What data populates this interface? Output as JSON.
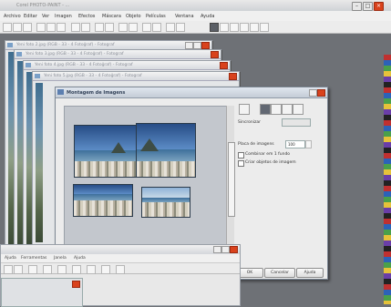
{
  "app": {
    "title": "Corel PHOTO-PAINT - ...",
    "menu": [
      "Archivo",
      "Editar",
      "Ver",
      "Imagen",
      "Efectos",
      "Máscara",
      "Objeto",
      "Películas",
      "Ventana",
      "Ayuda"
    ]
  },
  "documents": [
    {
      "title": "Yeni foto 2.jpg (RGB - 33 - 4 Fotoğraf) - Fotograf"
    },
    {
      "title": "Yeni foto 3.jpg (RGB - 33 - 4 Fotoğraf) - Fotograf"
    },
    {
      "title": "Yeni foto 4.jpg (RGB - 33 - 4 Fotoğraf) - Fotograf"
    },
    {
      "title": "Yeni foto 5.jpg (RGB - 33 - 4 Fotoğraf) - Fotograf"
    }
  ],
  "dialog": {
    "title": "Montagem de Imagens",
    "label_order": "Sincronizar",
    "label_size": "Placa de imagens",
    "size_value": "100",
    "option_1": "Combinar em 1 fundo",
    "option_2": "Criar objetos de imagem",
    "buttons": {
      "ok": "OK",
      "cancel": "Cancelar",
      "help": "Ajuda"
    }
  },
  "window2": {
    "menu": [
      "Ajuda",
      "Ferramentas",
      "Janela",
      "Ajuda"
    ]
  },
  "colors": {
    "workspace": "#6e7176",
    "close": "#d9421c"
  }
}
